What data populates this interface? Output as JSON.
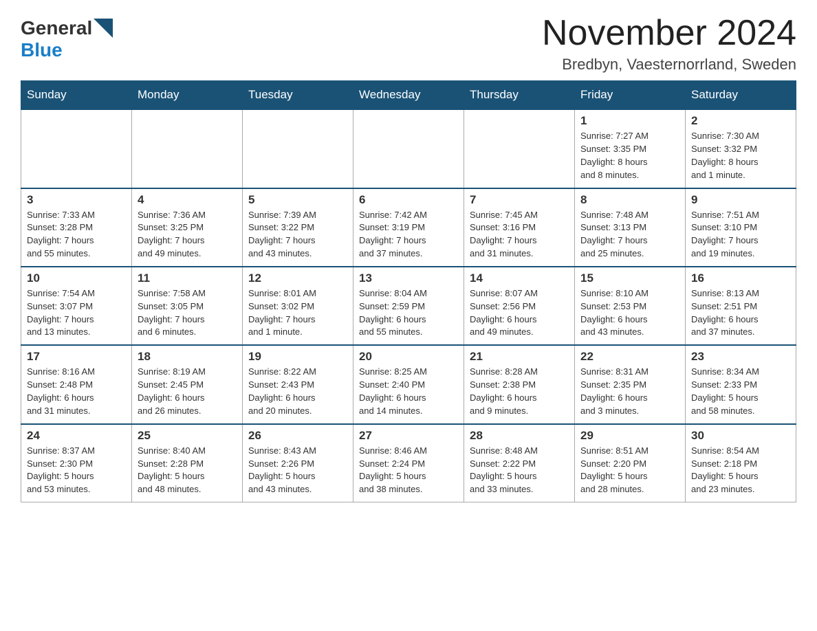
{
  "header": {
    "month_title": "November 2024",
    "location": "Bredbyn, Vaesternorrland, Sweden",
    "logo_general": "General",
    "logo_blue": "Blue"
  },
  "weekdays": [
    "Sunday",
    "Monday",
    "Tuesday",
    "Wednesday",
    "Thursday",
    "Friday",
    "Saturday"
  ],
  "weeks": [
    {
      "days": [
        {
          "num": "",
          "info": ""
        },
        {
          "num": "",
          "info": ""
        },
        {
          "num": "",
          "info": ""
        },
        {
          "num": "",
          "info": ""
        },
        {
          "num": "",
          "info": ""
        },
        {
          "num": "1",
          "info": "Sunrise: 7:27 AM\nSunset: 3:35 PM\nDaylight: 8 hours\nand 8 minutes."
        },
        {
          "num": "2",
          "info": "Sunrise: 7:30 AM\nSunset: 3:32 PM\nDaylight: 8 hours\nand 1 minute."
        }
      ]
    },
    {
      "days": [
        {
          "num": "3",
          "info": "Sunrise: 7:33 AM\nSunset: 3:28 PM\nDaylight: 7 hours\nand 55 minutes."
        },
        {
          "num": "4",
          "info": "Sunrise: 7:36 AM\nSunset: 3:25 PM\nDaylight: 7 hours\nand 49 minutes."
        },
        {
          "num": "5",
          "info": "Sunrise: 7:39 AM\nSunset: 3:22 PM\nDaylight: 7 hours\nand 43 minutes."
        },
        {
          "num": "6",
          "info": "Sunrise: 7:42 AM\nSunset: 3:19 PM\nDaylight: 7 hours\nand 37 minutes."
        },
        {
          "num": "7",
          "info": "Sunrise: 7:45 AM\nSunset: 3:16 PM\nDaylight: 7 hours\nand 31 minutes."
        },
        {
          "num": "8",
          "info": "Sunrise: 7:48 AM\nSunset: 3:13 PM\nDaylight: 7 hours\nand 25 minutes."
        },
        {
          "num": "9",
          "info": "Sunrise: 7:51 AM\nSunset: 3:10 PM\nDaylight: 7 hours\nand 19 minutes."
        }
      ]
    },
    {
      "days": [
        {
          "num": "10",
          "info": "Sunrise: 7:54 AM\nSunset: 3:07 PM\nDaylight: 7 hours\nand 13 minutes."
        },
        {
          "num": "11",
          "info": "Sunrise: 7:58 AM\nSunset: 3:05 PM\nDaylight: 7 hours\nand 6 minutes."
        },
        {
          "num": "12",
          "info": "Sunrise: 8:01 AM\nSunset: 3:02 PM\nDaylight: 7 hours\nand 1 minute."
        },
        {
          "num": "13",
          "info": "Sunrise: 8:04 AM\nSunset: 2:59 PM\nDaylight: 6 hours\nand 55 minutes."
        },
        {
          "num": "14",
          "info": "Sunrise: 8:07 AM\nSunset: 2:56 PM\nDaylight: 6 hours\nand 49 minutes."
        },
        {
          "num": "15",
          "info": "Sunrise: 8:10 AM\nSunset: 2:53 PM\nDaylight: 6 hours\nand 43 minutes."
        },
        {
          "num": "16",
          "info": "Sunrise: 8:13 AM\nSunset: 2:51 PM\nDaylight: 6 hours\nand 37 minutes."
        }
      ]
    },
    {
      "days": [
        {
          "num": "17",
          "info": "Sunrise: 8:16 AM\nSunset: 2:48 PM\nDaylight: 6 hours\nand 31 minutes."
        },
        {
          "num": "18",
          "info": "Sunrise: 8:19 AM\nSunset: 2:45 PM\nDaylight: 6 hours\nand 26 minutes."
        },
        {
          "num": "19",
          "info": "Sunrise: 8:22 AM\nSunset: 2:43 PM\nDaylight: 6 hours\nand 20 minutes."
        },
        {
          "num": "20",
          "info": "Sunrise: 8:25 AM\nSunset: 2:40 PM\nDaylight: 6 hours\nand 14 minutes."
        },
        {
          "num": "21",
          "info": "Sunrise: 8:28 AM\nSunset: 2:38 PM\nDaylight: 6 hours\nand 9 minutes."
        },
        {
          "num": "22",
          "info": "Sunrise: 8:31 AM\nSunset: 2:35 PM\nDaylight: 6 hours\nand 3 minutes."
        },
        {
          "num": "23",
          "info": "Sunrise: 8:34 AM\nSunset: 2:33 PM\nDaylight: 5 hours\nand 58 minutes."
        }
      ]
    },
    {
      "days": [
        {
          "num": "24",
          "info": "Sunrise: 8:37 AM\nSunset: 2:30 PM\nDaylight: 5 hours\nand 53 minutes."
        },
        {
          "num": "25",
          "info": "Sunrise: 8:40 AM\nSunset: 2:28 PM\nDaylight: 5 hours\nand 48 minutes."
        },
        {
          "num": "26",
          "info": "Sunrise: 8:43 AM\nSunset: 2:26 PM\nDaylight: 5 hours\nand 43 minutes."
        },
        {
          "num": "27",
          "info": "Sunrise: 8:46 AM\nSunset: 2:24 PM\nDaylight: 5 hours\nand 38 minutes."
        },
        {
          "num": "28",
          "info": "Sunrise: 8:48 AM\nSunset: 2:22 PM\nDaylight: 5 hours\nand 33 minutes."
        },
        {
          "num": "29",
          "info": "Sunrise: 8:51 AM\nSunset: 2:20 PM\nDaylight: 5 hours\nand 28 minutes."
        },
        {
          "num": "30",
          "info": "Sunrise: 8:54 AM\nSunset: 2:18 PM\nDaylight: 5 hours\nand 23 minutes."
        }
      ]
    }
  ]
}
